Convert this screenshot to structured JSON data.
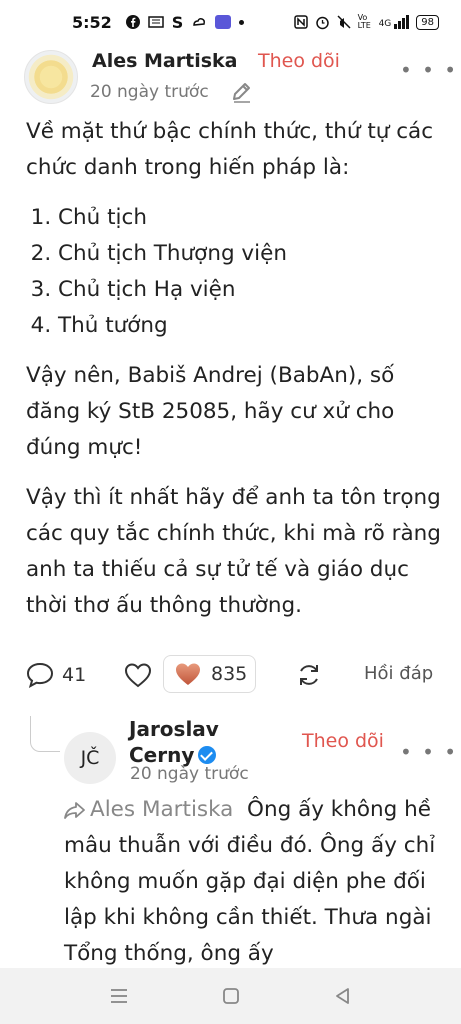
{
  "status_bar": {
    "time": "5:52",
    "left_icons": [
      "facebook-icon",
      "news-icon",
      "s-app-icon",
      "weather-icon",
      "app-square-icon",
      "dot-icon"
    ],
    "right_icons": [
      "nfc-icon",
      "alarm-icon",
      "mute-icon",
      "volte-icon",
      "signal-icon",
      "battery-icon"
    ],
    "volte_text": "Vo LTE",
    "signal_text": "4G",
    "battery": "98"
  },
  "post": {
    "author": "Ales Martiska",
    "follow_label": "Theo dõi",
    "time": "20 ngày trước",
    "intro": "Về mặt thứ bậc chính thức, thứ tự các chức danh trong hiến pháp là:",
    "list": [
      "Chủ tịch",
      "Chủ tịch Thượng viện",
      "Chủ tịch Hạ viện",
      "Thủ tướng"
    ],
    "paragraph2": "Vậy nên, Babiš Andrej (BabAn), số đăng ký StB 25085, hãy cư xử cho đúng mực!",
    "paragraph3": "Vậy thì ít nhất hãy để anh ta tôn trọng các quy tắc chính thức, khi mà rõ ràng anh ta thiếu cả sự tử tế và giáo dục thời thơ ấu thông thường.",
    "comment_count": "41",
    "reaction_count": "835",
    "reply_label": "Hồi đáp"
  },
  "reply": {
    "avatar_initials": "JČ",
    "author": "Jaroslav Cerny",
    "follow_label": "Theo dõi",
    "time": "20 ngày trước",
    "mention": "Ales Martiska",
    "text": "Ông ấy không hề mâu thuẫn với điều đó. Ông ấy chỉ không muốn gặp đại diện phe đối lập khi không cần thiết. Thưa ngài Tổng thống, ông ấy"
  },
  "nav": [
    "menu-icon",
    "home-icon",
    "back-icon"
  ],
  "colors": {
    "accent": "#e0564f",
    "verified": "#1d8cf0",
    "muted": "#777777"
  }
}
